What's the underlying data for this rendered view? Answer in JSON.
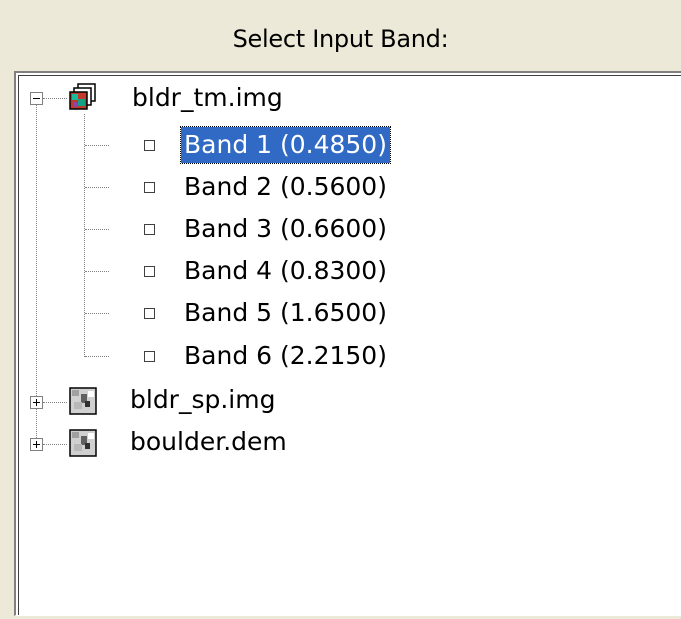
{
  "header": {
    "title": "Select Input Band:"
  },
  "tree": {
    "root": {
      "label": "bldr_tm.img",
      "expanded": true,
      "bands": [
        {
          "label": "Band 1 (0.4850)",
          "selected": true
        },
        {
          "label": "Band 2 (0.5600)",
          "selected": false
        },
        {
          "label": "Band 3 (0.6600)",
          "selected": false
        },
        {
          "label": "Band 4 (0.8300)",
          "selected": false
        },
        {
          "label": "Band 5 (1.6500)",
          "selected": false
        },
        {
          "label": "Band 6 (2.2150)",
          "selected": false
        }
      ]
    },
    "others": [
      {
        "label": "bldr_sp.img",
        "expanded": false
      },
      {
        "label": "boulder.dem",
        "expanded": false
      }
    ]
  },
  "colors": {
    "selection": "#316ac5",
    "background": "#ece9d8",
    "tree_bg": "#ffffff"
  }
}
